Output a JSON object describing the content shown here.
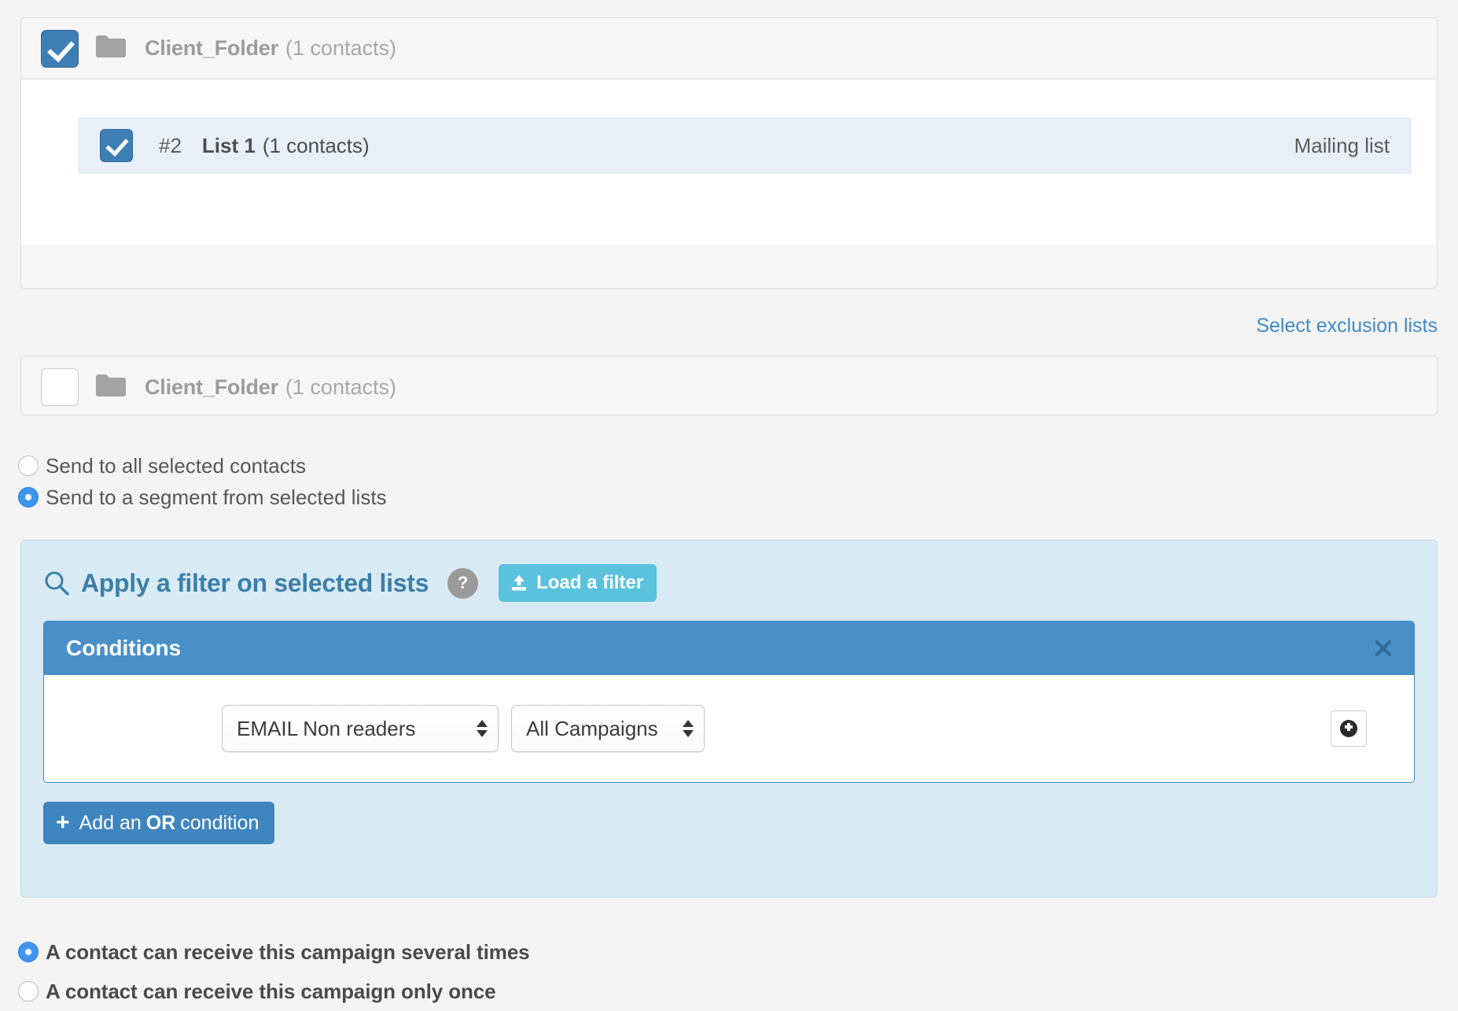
{
  "colors": {
    "accent_blue": "#3d7fb5",
    "link_blue": "#3f8ac8",
    "panel_blue": "#d8eaf4",
    "header_blue": "#4a90c8",
    "load_filter_cyan": "#5bc2dd",
    "radio_on": "#3e96f0",
    "page_bg": "#f4f4f4"
  },
  "inclusion_panel": {
    "checkbox_state": "checked",
    "folder_icon": "folder-icon",
    "folder_name": "Client_Folder",
    "folder_count": "(1 contacts)",
    "lists": [
      {
        "checkbox_state": "checked",
        "number": "#2",
        "name": "List 1",
        "count": "(1 contacts)",
        "type": "Mailing list"
      }
    ]
  },
  "exclusion_link": {
    "label": "Select exclusion lists"
  },
  "exclusion_panel": {
    "checkbox_state": "unchecked",
    "folder_icon": "folder-icon",
    "folder_name": "Client_Folder",
    "folder_count": "(1 contacts)"
  },
  "send_mode": {
    "options": [
      {
        "label": "Send to all selected contacts",
        "selected": false
      },
      {
        "label": "Send to a segment from selected lists",
        "selected": true
      }
    ]
  },
  "filter": {
    "search_icon": "search-icon",
    "title": "Apply a filter on selected lists",
    "help_badge": "?",
    "load_button": {
      "icon": "upload-icon",
      "label": "Load a filter"
    },
    "conditions": {
      "title": "Conditions",
      "close_icon": "close-icon",
      "rows": [
        {
          "field_select": {
            "value": "EMAIL Non readers",
            "options": [
              "EMAIL Non readers"
            ]
          },
          "scope_select": {
            "value": "All Campaigns",
            "options": [
              "All Campaigns"
            ]
          },
          "add_icon": "plus-circle-icon"
        }
      ]
    },
    "or_button": {
      "plus": "+",
      "prefix": "Add an",
      "bold": "OR",
      "suffix": "condition"
    }
  },
  "frequency": {
    "options": [
      {
        "label": "A contact can receive this campaign several times",
        "selected": true
      },
      {
        "label": "A contact can receive this campaign only once",
        "selected": false
      }
    ]
  }
}
